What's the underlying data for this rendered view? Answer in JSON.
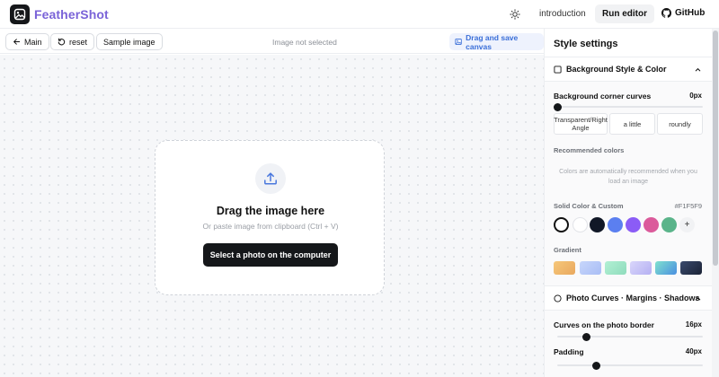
{
  "header": {
    "app_name": "FeatherShot",
    "nav_intro": "introduction",
    "nav_run": "Run editor",
    "nav_github": "GitHub"
  },
  "toolbar": {
    "main": "Main",
    "reset": "reset",
    "sample": "Sample image",
    "status": "Image not selected",
    "drag_save": "Drag and save canvas"
  },
  "dropzone": {
    "title": "Drag the image here",
    "subtitle": "Or paste image from clipboard (Ctrl + V)",
    "button": "Select a photo on the computer"
  },
  "panel": {
    "title": "Style settings",
    "background_section": {
      "title": "Background Style & Color",
      "corner_label": "Background corner curves",
      "corner_value": "0px",
      "corner_level": 0,
      "corner_options": [
        "Transparent/Right Angle",
        "a little",
        "roundly"
      ],
      "recommended_label": "Recommended colors",
      "recommended_hint": "Colors are automatically recommended when you load an image",
      "solid_label": "Solid Color & Custom",
      "solid_hex": "#F1F5F9",
      "swatches": [
        "#ffffff",
        "#ffffff",
        "#111827",
        "#5b7ff0",
        "#8b5cf6",
        "#db5a9b",
        "#5ab48a"
      ],
      "add_label": "+",
      "gradient_label": "Gradient",
      "gradients": [
        [
          "#f6c77a",
          "#e9a85e"
        ],
        [
          "#c7d6fb",
          "#a9bdf5"
        ],
        [
          "#b2f0d4",
          "#8fdcbc"
        ],
        [
          "#d9d6fb",
          "#b5b0f2"
        ],
        [
          "#7fe2cf",
          "#4a8fe0"
        ],
        [
          "#3a4a6d",
          "#1b2336"
        ]
      ]
    },
    "photo_section": {
      "title": "Photo Curves · Margins · Shadows",
      "curves_label": "Curves on the photo border",
      "curves_value": "16px",
      "curves_level": 0.2,
      "padding_label": "Padding",
      "padding_value": "40px",
      "padding_level": 0.27
    }
  }
}
